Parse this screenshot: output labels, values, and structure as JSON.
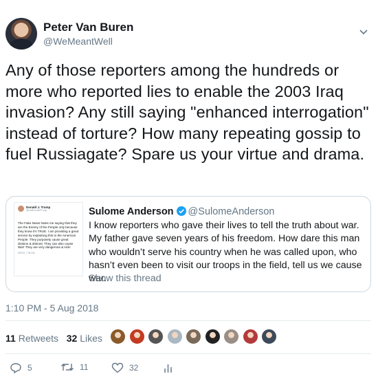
{
  "author": {
    "name": "Peter Van Buren",
    "handle": "@WeMeantWell"
  },
  "tweet": {
    "text": "Any of those reporters among the hundreds or more who reported lies to enable the 2003 Iraq invasion? Any still saying \"enhanced interrogation\" instead of torture? How many repeating gossip to fuel Russiagate? Spare us your virtue and drama.",
    "timestamp": "1:10 PM - 5 Aug 2018"
  },
  "quoted": {
    "name": "Sulome Anderson",
    "handle": "@SulomeAnderson",
    "text": "I know reporters who gave their lives to tell the truth about war. My father gave seven years of his freedom. How dare this man who wouldn’t serve his country when he was called upon, who hasn’t even been to visit our troops in the field, tell us we cause war.",
    "show_thread": "Show this thread",
    "image": {
      "name": "Donald J. Trump",
      "handle": "@realDonaldTrump",
      "body": "The Fake News hates me saying that they are the Enemy of the People only because they know it’s TRUE. I am providing a great service by explaining this to the American People. They purposely cause great division & distrust. They can also cause War! They are very dangerous & sick!",
      "date": "8/5/18, 7:38 AM"
    }
  },
  "stats": {
    "retweets_count": "11",
    "retweets_label": "Retweets",
    "likes_count": "32",
    "likes_label": "Likes"
  },
  "likers": [
    {
      "icon": "liker-avatar",
      "color": "#8a5a2b"
    },
    {
      "icon": "liker-avatar",
      "color": "#c23b22"
    },
    {
      "icon": "liker-avatar",
      "color": "#555555"
    },
    {
      "icon": "liker-avatar",
      "color": "#aab8c2"
    },
    {
      "icon": "liker-avatar",
      "color": "#7a6a5a"
    },
    {
      "icon": "liker-avatar",
      "color": "#222222"
    },
    {
      "icon": "liker-avatar",
      "color": "#9a8f86"
    },
    {
      "icon": "liker-avatar",
      "color": "#b43b3b"
    },
    {
      "icon": "liker-avatar",
      "color": "#3c4a5a"
    }
  ],
  "actions": {
    "reply_count": "5",
    "retweet_count": "11",
    "like_count": "32"
  },
  "colors": {
    "text": "#14171a",
    "secondary": "#657786",
    "border": "#e6ecf0",
    "verified": "#1da1f2"
  }
}
